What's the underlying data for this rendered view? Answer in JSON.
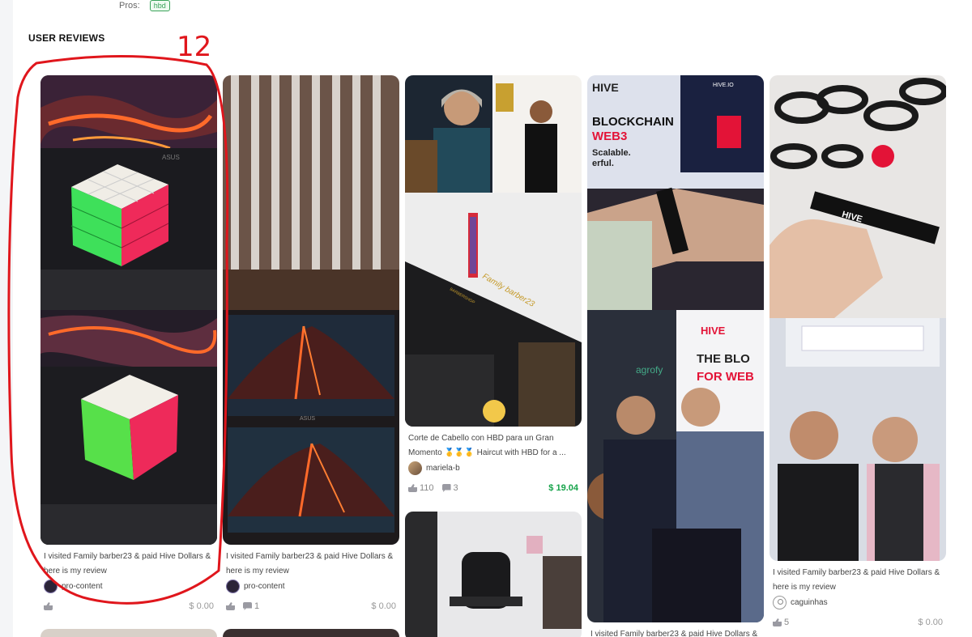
{
  "pros": {
    "label": "Pros:",
    "tag": "hbd"
  },
  "section_title": "USER REVIEWS",
  "annotation": {
    "number": "12"
  },
  "cards": [
    {
      "title_l1": "I visited Family barber23 & paid Hive Dollars &",
      "title_l2": "here is my review",
      "author": "pro-content",
      "likes": "",
      "comments": "",
      "payout": "$ 0.00"
    },
    {
      "title_l1": "I visited Family barber23 & paid Hive Dollars &",
      "title_l2": "here is my review",
      "author": "pro-content",
      "likes": "",
      "comments": "1",
      "payout": "$ 0.00"
    },
    {
      "title_l1": "Corte de Cabello con HBD para un Gran",
      "title_l2": "Momento 🥇🥇🥇 Haircut with HBD for a ...",
      "author": "mariela-b",
      "likes": "110",
      "comments": "3",
      "payout": "$ 19.04"
    },
    {
      "title_l1": "I visited Family barber23 & paid Hive Dollars &",
      "title_l2": "",
      "author": "",
      "likes": "",
      "comments": "",
      "payout": ""
    },
    {
      "title_l1": "I visited Family barber23 & paid Hive Dollars &",
      "title_l2": "here is my review",
      "author": "caguinhas",
      "likes": "5",
      "comments": "",
      "payout": "$ 0.00"
    }
  ],
  "photo_text": {
    "asus": "ASUS",
    "barber_sign": "Family barber23",
    "barber_sub": "BARBERSHOP",
    "hive": "HIVE",
    "hive_io": "HIVE.IO",
    "blockchain": "BLOCKCHAIN",
    "web3": "WEB3",
    "scalable": "Scalable.",
    "erful": "erful.",
    "the_blo": "THE BLO",
    "for_web": "FOR WEB",
    "agrofy": "agrofy",
    "band": "HIVE"
  },
  "colors": {
    "annotation": "#e0161c",
    "payout_green": "#16a34a"
  }
}
